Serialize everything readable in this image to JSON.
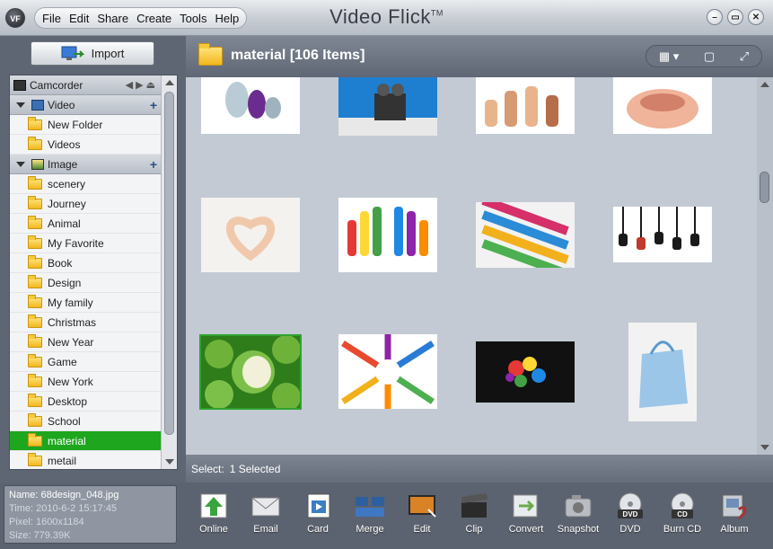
{
  "app": {
    "logo_text": "VF",
    "title": "Video Flick",
    "trademark": "TM"
  },
  "menu": [
    "File",
    "Edit",
    "Share",
    "Create",
    "Tools",
    "Help"
  ],
  "window_controls": {
    "minimize": "–",
    "maximize": "▭",
    "close": "✕"
  },
  "import_button": "Import",
  "tree": {
    "camcorder": "Camcorder",
    "video_group": "Video",
    "video_items": [
      "New Folder",
      "Videos"
    ],
    "image_group": "Image",
    "image_items": [
      "scenery",
      "Journey",
      "Animal",
      "My Favorite",
      "Book",
      "Design",
      "My family",
      "Christmas",
      "New Year",
      "Game",
      "New York",
      "Desktop",
      "School",
      "material",
      "metail"
    ],
    "selected_item": "material"
  },
  "content": {
    "folder_title": "material [106 Items]",
    "view_icons": [
      "grid-view-icon",
      "single-view-icon",
      "fullscreen-icon"
    ]
  },
  "thumbnails": [
    {
      "name": "glass-bottles",
      "colors": [
        "#ffffff",
        "#8fa9b8",
        "#6a2c8e"
      ]
    },
    {
      "name": "robot-toy",
      "colors": [
        "#1e7fd0",
        "#222222",
        "#e8e8e8"
      ]
    },
    {
      "name": "thumbs-up-hands",
      "colors": [
        "#ffffff",
        "#e9b48c",
        "#b56d4a"
      ]
    },
    {
      "name": "cupped-hands",
      "colors": [
        "#ffffff",
        "#f0b49a",
        "#d2806a"
      ]
    },
    {
      "name": "heart-hands",
      "colors": [
        "#f4f2ef",
        "#f0c9ad",
        "#d89a7a"
      ]
    },
    {
      "name": "painted-hands",
      "colors": [
        "#ffffff",
        "#e53935",
        "#1e88e5"
      ]
    },
    {
      "name": "color-combs",
      "colors": [
        "#f2f2f2",
        "#d62f6a",
        "#2a8bd6"
      ]
    },
    {
      "name": "hanging-phones",
      "colors": [
        "#ffffff",
        "#1a1a1a",
        "#b0b0b0"
      ]
    },
    {
      "name": "green-apples",
      "colors": [
        "#2e7d1a",
        "#7cc04a",
        "#f2f0d8"
      ]
    },
    {
      "name": "color-pencils",
      "colors": [
        "#ffffff",
        "#e84a2e",
        "#2a7bd6"
      ]
    },
    {
      "name": "color-doodle",
      "colors": [
        "#111111",
        "#e53935",
        "#fdd835"
      ]
    },
    {
      "name": "blue-gift-bag",
      "colors": [
        "#f2f2f2",
        "#9cc6e8",
        "#5a9ad0"
      ]
    }
  ],
  "status": {
    "label": "Select:",
    "value": "1 Selected"
  },
  "file_info": {
    "name": "Name: 68design_048.jpg",
    "time": "Time: 2010-6-2 15:17:45",
    "pixel": "Pixel: 1600x1184",
    "size": "Size: 779.39K"
  },
  "tools": [
    {
      "label": "Online",
      "icon": "online-icon",
      "color": "#39a33d"
    },
    {
      "label": "Email",
      "icon": "email-icon",
      "color": "#d9dde2"
    },
    {
      "label": "Card",
      "icon": "card-icon",
      "color": "#3c7fc4"
    },
    {
      "label": "Merge",
      "icon": "merge-icon",
      "color": "#2d5f9e"
    },
    {
      "label": "Edit",
      "icon": "edit-icon",
      "color": "#d98226"
    },
    {
      "label": "Clip",
      "icon": "clip-icon",
      "color": "#2b2b2b"
    },
    {
      "label": "Convert",
      "icon": "convert-icon",
      "color": "#6dab4a"
    },
    {
      "label": "Snapshot",
      "icon": "snapshot-icon",
      "color": "#b8bcc3"
    },
    {
      "label": "DVD",
      "icon": "dvd-icon",
      "color": "#e1e4e8"
    },
    {
      "label": "Burn CD",
      "icon": "burn-cd-icon",
      "color": "#e1e4e8"
    },
    {
      "label": "Album",
      "icon": "album-icon",
      "color": "#c7ccd3"
    }
  ]
}
